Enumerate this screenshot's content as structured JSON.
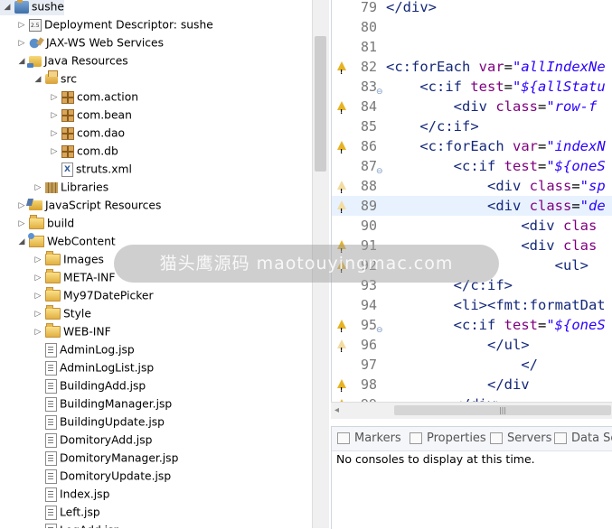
{
  "explorer": {
    "items": [
      {
        "label": "sushe",
        "icon": "project-icon",
        "depth": 0,
        "toggle": "expanded",
        "name": "tree-item-sushe"
      },
      {
        "label": "Deployment Descriptor: sushe",
        "icon": "deployment-descriptor-icon",
        "depth": 1,
        "toggle": "collapsed",
        "name": "tree-item-deployment-descriptor"
      },
      {
        "label": "JAX-WS Web Services",
        "icon": "web-services-icon",
        "depth": 1,
        "toggle": "collapsed",
        "name": "tree-item-jaxws"
      },
      {
        "label": "Java Resources",
        "icon": "java-resources-icon",
        "depth": 1,
        "toggle": "expanded",
        "name": "tree-item-java-resources"
      },
      {
        "label": "src",
        "icon": "source-folder-icon",
        "depth": 2,
        "toggle": "expanded",
        "name": "tree-item-src"
      },
      {
        "label": "com.action",
        "icon": "package-icon",
        "depth": 3,
        "toggle": "collapsed",
        "name": "tree-item-com-action"
      },
      {
        "label": "com.bean",
        "icon": "package-icon",
        "depth": 3,
        "toggle": "collapsed",
        "name": "tree-item-com-bean"
      },
      {
        "label": "com.dao",
        "icon": "package-icon",
        "depth": 3,
        "toggle": "collapsed",
        "name": "tree-item-com-dao"
      },
      {
        "label": "com.db",
        "icon": "package-icon",
        "depth": 3,
        "toggle": "collapsed",
        "name": "tree-item-com-db"
      },
      {
        "label": "struts.xml",
        "icon": "xml-file-icon",
        "depth": 3,
        "toggle": "none",
        "name": "tree-item-struts-xml"
      },
      {
        "label": "Libraries",
        "icon": "libraries-icon",
        "depth": 2,
        "toggle": "collapsed",
        "name": "tree-item-libraries"
      },
      {
        "label": "JavaScript Resources",
        "icon": "javascript-resources-icon",
        "depth": 1,
        "toggle": "collapsed",
        "name": "tree-item-javascript-resources"
      },
      {
        "label": "build",
        "icon": "folder-icon",
        "depth": 1,
        "toggle": "collapsed",
        "name": "tree-item-build"
      },
      {
        "label": "WebContent",
        "icon": "web-content-icon",
        "depth": 1,
        "toggle": "expanded",
        "name": "tree-item-webcontent"
      },
      {
        "label": "Images",
        "icon": "folder-icon",
        "depth": 2,
        "toggle": "collapsed",
        "name": "tree-item-images"
      },
      {
        "label": "META-INF",
        "icon": "folder-icon",
        "depth": 2,
        "toggle": "collapsed",
        "name": "tree-item-meta-inf"
      },
      {
        "label": "My97DatePicker",
        "icon": "folder-icon",
        "depth": 2,
        "toggle": "collapsed",
        "name": "tree-item-my97datepicker"
      },
      {
        "label": "Style",
        "icon": "folder-icon",
        "depth": 2,
        "toggle": "collapsed",
        "name": "tree-item-style"
      },
      {
        "label": "WEB-INF",
        "icon": "folder-icon",
        "depth": 2,
        "toggle": "collapsed",
        "name": "tree-item-web-inf"
      },
      {
        "label": "AdminLog.jsp",
        "icon": "jsp-file-icon",
        "depth": 2,
        "toggle": "none",
        "name": "tree-item-adminlog-jsp"
      },
      {
        "label": "AdminLogList.jsp",
        "icon": "jsp-file-icon",
        "depth": 2,
        "toggle": "none",
        "name": "tree-item-adminloglist-jsp"
      },
      {
        "label": "BuildingAdd.jsp",
        "icon": "jsp-file-icon",
        "depth": 2,
        "toggle": "none",
        "name": "tree-item-buildingadd-jsp"
      },
      {
        "label": "BuildingManager.jsp",
        "icon": "jsp-file-icon",
        "depth": 2,
        "toggle": "none",
        "name": "tree-item-buildingmanager-jsp"
      },
      {
        "label": "BuildingUpdate.jsp",
        "icon": "jsp-file-icon",
        "depth": 2,
        "toggle": "none",
        "name": "tree-item-buildingupdate-jsp"
      },
      {
        "label": "DomitoryAdd.jsp",
        "icon": "jsp-file-icon",
        "depth": 2,
        "toggle": "none",
        "name": "tree-item-domitoryadd-jsp"
      },
      {
        "label": "DomitoryManager.jsp",
        "icon": "jsp-file-icon",
        "depth": 2,
        "toggle": "none",
        "name": "tree-item-domitorymanager-jsp"
      },
      {
        "label": "DomitoryUpdate.jsp",
        "icon": "jsp-file-icon",
        "depth": 2,
        "toggle": "none",
        "name": "tree-item-domitoryupdate-jsp"
      },
      {
        "label": "Index.jsp",
        "icon": "jsp-file-icon",
        "depth": 2,
        "toggle": "none",
        "name": "tree-item-index-jsp"
      },
      {
        "label": "Left.jsp",
        "icon": "jsp-file-icon",
        "depth": 2,
        "toggle": "none",
        "name": "tree-item-left-jsp"
      },
      {
        "label": "LogAdd.jsp",
        "icon": "jsp-file-icon",
        "depth": 2,
        "toggle": "none",
        "name": "tree-item-logadd-jsp"
      }
    ]
  },
  "editor": {
    "lines": [
      {
        "num": "79",
        "marker": "",
        "fold": false,
        "hl": false,
        "tokens": [
          [
            "tag",
            "</div>"
          ]
        ]
      },
      {
        "num": "80",
        "marker": "",
        "fold": false,
        "hl": false,
        "tokens": []
      },
      {
        "num": "81",
        "marker": "",
        "fold": false,
        "hl": false,
        "tokens": []
      },
      {
        "num": "82",
        "marker": "warning",
        "fold": false,
        "hl": false,
        "tokens": [
          [
            "tag",
            "<c:forEach "
          ],
          [
            "attr",
            "var"
          ],
          [
            "txt",
            "="
          ],
          [
            "val",
            "\"allIndexNe"
          ]
        ]
      },
      {
        "num": "83",
        "marker": "",
        "fold": true,
        "hl": false,
        "tokens": [
          [
            "txt",
            "    "
          ],
          [
            "tag",
            "<c:if "
          ],
          [
            "attr",
            "test"
          ],
          [
            "txt",
            "="
          ],
          [
            "val",
            "\"${allStatu"
          ]
        ]
      },
      {
        "num": "84",
        "marker": "warning",
        "fold": false,
        "hl": false,
        "tokens": [
          [
            "txt",
            "        "
          ],
          [
            "tag",
            "<div "
          ],
          [
            "attr",
            "class"
          ],
          [
            "txt",
            "="
          ],
          [
            "val",
            "\"row-f"
          ]
        ]
      },
      {
        "num": "85",
        "marker": "",
        "fold": false,
        "hl": false,
        "tokens": [
          [
            "txt",
            "    "
          ],
          [
            "tag",
            "</c:if>"
          ]
        ]
      },
      {
        "num": "86",
        "marker": "warning",
        "fold": false,
        "hl": false,
        "tokens": [
          [
            "txt",
            "    "
          ],
          [
            "tag",
            "<c:forEach "
          ],
          [
            "attr",
            "var"
          ],
          [
            "txt",
            "="
          ],
          [
            "val",
            "\"indexN"
          ]
        ]
      },
      {
        "num": "87",
        "marker": "",
        "fold": true,
        "hl": false,
        "tokens": [
          [
            "txt",
            "        "
          ],
          [
            "tag",
            "<c:if "
          ],
          [
            "attr",
            "test"
          ],
          [
            "txt",
            "="
          ],
          [
            "val",
            "\"${oneS"
          ]
        ]
      },
      {
        "num": "88",
        "marker": "warning-pale",
        "fold": false,
        "hl": false,
        "tokens": [
          [
            "txt",
            "            "
          ],
          [
            "tag",
            "<div "
          ],
          [
            "attr",
            "class"
          ],
          [
            "txt",
            "="
          ],
          [
            "val",
            "\"sp"
          ]
        ]
      },
      {
        "num": "89",
        "marker": "warning-pale",
        "fold": false,
        "hl": true,
        "tokens": [
          [
            "txt",
            "            "
          ],
          [
            "tag",
            "<div "
          ],
          [
            "attr",
            "class"
          ],
          [
            "txt",
            "="
          ],
          [
            "val",
            "\"de"
          ]
        ]
      },
      {
        "num": "90",
        "marker": "",
        "fold": false,
        "hl": false,
        "tokens": [
          [
            "txt",
            "                "
          ],
          [
            "tag",
            "<div "
          ],
          [
            "attr",
            "clas"
          ]
        ]
      },
      {
        "num": "91",
        "marker": "warning",
        "fold": false,
        "hl": false,
        "tokens": [
          [
            "txt",
            "                "
          ],
          [
            "tag",
            "<div "
          ],
          [
            "attr",
            "clas"
          ]
        ]
      },
      {
        "num": "92",
        "marker": "warning",
        "fold": false,
        "hl": false,
        "tokens": [
          [
            "txt",
            "                    "
          ],
          [
            "tag",
            "<ul>"
          ]
        ]
      },
      {
        "num": "93",
        "marker": "",
        "fold": false,
        "hl": false,
        "tokens": [
          [
            "txt",
            "        "
          ],
          [
            "tag",
            "</c:if>"
          ]
        ]
      },
      {
        "num": "94",
        "marker": "",
        "fold": false,
        "hl": false,
        "tokens": [
          [
            "txt",
            "        "
          ],
          [
            "tag",
            "<li><fmt:formatDat"
          ]
        ]
      },
      {
        "num": "95",
        "marker": "warning",
        "fold": true,
        "hl": false,
        "tokens": [
          [
            "txt",
            "        "
          ],
          [
            "tag",
            "<c:if "
          ],
          [
            "attr",
            "test"
          ],
          [
            "txt",
            "="
          ],
          [
            "val",
            "\"${oneS"
          ]
        ]
      },
      {
        "num": "96",
        "marker": "warning-pale",
        "fold": false,
        "hl": false,
        "tokens": [
          [
            "txt",
            "            "
          ],
          [
            "tag",
            "</ul>"
          ]
        ]
      },
      {
        "num": "97",
        "marker": "",
        "fold": false,
        "hl": false,
        "tokens": [
          [
            "txt",
            "                "
          ],
          [
            "tag",
            "</"
          ]
        ]
      },
      {
        "num": "98",
        "marker": "warning",
        "fold": false,
        "hl": false,
        "tokens": [
          [
            "txt",
            "            "
          ],
          [
            "tag",
            "</div"
          ]
        ]
      },
      {
        "num": "99",
        "marker": "warning",
        "fold": false,
        "hl": false,
        "tokens": [
          [
            "txt",
            "        "
          ],
          [
            "tag",
            "</div>"
          ]
        ]
      }
    ]
  },
  "hscroll": {
    "thumb_grip": "|||"
  },
  "panel": {
    "tabs": [
      {
        "label": "Markers",
        "name": "tab-markers",
        "icon": "markers-icon"
      },
      {
        "label": "Properties",
        "name": "tab-properties",
        "icon": "properties-icon"
      },
      {
        "label": "Servers",
        "name": "tab-servers",
        "icon": "servers-icon"
      },
      {
        "label": "Data So",
        "name": "tab-data-source",
        "icon": "data-source-icon"
      }
    ],
    "console_message": "No consoles to display at this time."
  },
  "watermark": {
    "text": "猫头鹰源码 maotouyingmac.com"
  }
}
